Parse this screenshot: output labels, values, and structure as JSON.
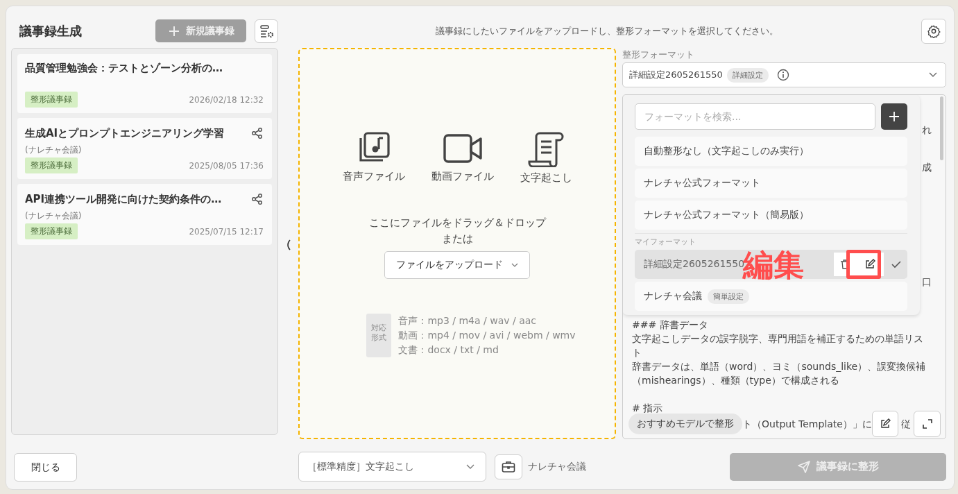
{
  "header": {
    "title": "議事録生成",
    "new_button": {
      "label": "新規議事録",
      "disabled": true
    },
    "hint": "議事録にしたいファイルをアップロードし、整形フォーマットを選択してください。"
  },
  "history": [
    {
      "title": "品質管理勉強会：テストとゾーン分析の…",
      "tag": "整形議事録",
      "date": "2026/02/18 12:32",
      "shared": false
    },
    {
      "title": "生成AIとプロンプトエンジニアリング学習",
      "meeting": "(ナレチャ会議)",
      "tag": "整形議事録",
      "date": "2025/08/05 17:36",
      "shared": true
    },
    {
      "title": "API連携ツール開発に向けた契約条件の…",
      "meeting": "(ナレチャ会議)",
      "tag": "整形議事録",
      "date": "2025/07/15 12:17",
      "shared": true
    }
  ],
  "close_button": "閉じる",
  "upload": {
    "sources": [
      {
        "kind": "audio",
        "label": "音声ファイル"
      },
      {
        "kind": "video",
        "label": "動画ファイル"
      },
      {
        "kind": "transcript",
        "label": "文字起こし"
      }
    ],
    "drop_text": "ここにファイルをドラッグ＆ドロップ",
    "or_text": "または",
    "upload_button": "ファイルをアップロード",
    "formats_label": "対応形式",
    "formats": [
      "音声：mp3 / m4a / wav / aac",
      "動画：mp4 / mov / avi / webm / wmv",
      "文書：docx / txt / md"
    ]
  },
  "transcription_select": "［標準精度］文字起こし",
  "meeting_type": "ナレチャ会議",
  "format": {
    "label": "整形フォーマット",
    "value": "詳細設定2605261550",
    "badge": "詳細設定",
    "dropdown": {
      "placeholder": "フォーマットを検索...",
      "items": [
        {
          "label": "自動整形なし（文字起こしのみ実行）",
          "selected": false
        },
        {
          "label": "ナレチャ公式フォーマット",
          "selected": false
        },
        {
          "label": "ナレチャ公式フォーマット（簡易版）",
          "selected": false
        }
      ],
      "section": "マイフォーマット",
      "my_items": [
        {
          "label": "詳細設定2605261550",
          "selected": true
        },
        {
          "label": "ナレチャ会議",
          "badge": "簡単設定",
          "selected": false
        }
      ]
    }
  },
  "prompt": {
    "tails": [
      "れ",
      "成",
      "口"
    ],
    "lines": [
      "### 辞書データ",
      "文字起こしデータの誤字脱字、専門用語を補正するための単語リスト",
      "辞書データは、単語（word）、ヨミ（sounds_like）、誤変換候補（mishearings）、種類（type）で構成される",
      "# 指示"
    ],
    "covered_line": "ト（Output Template）」に",
    "covered_tail": "従",
    "recommend_button": "おすすめモデルで整形"
  },
  "submit_button": {
    "label": "議事録に整形",
    "disabled": true
  },
  "annotation": "編集"
}
